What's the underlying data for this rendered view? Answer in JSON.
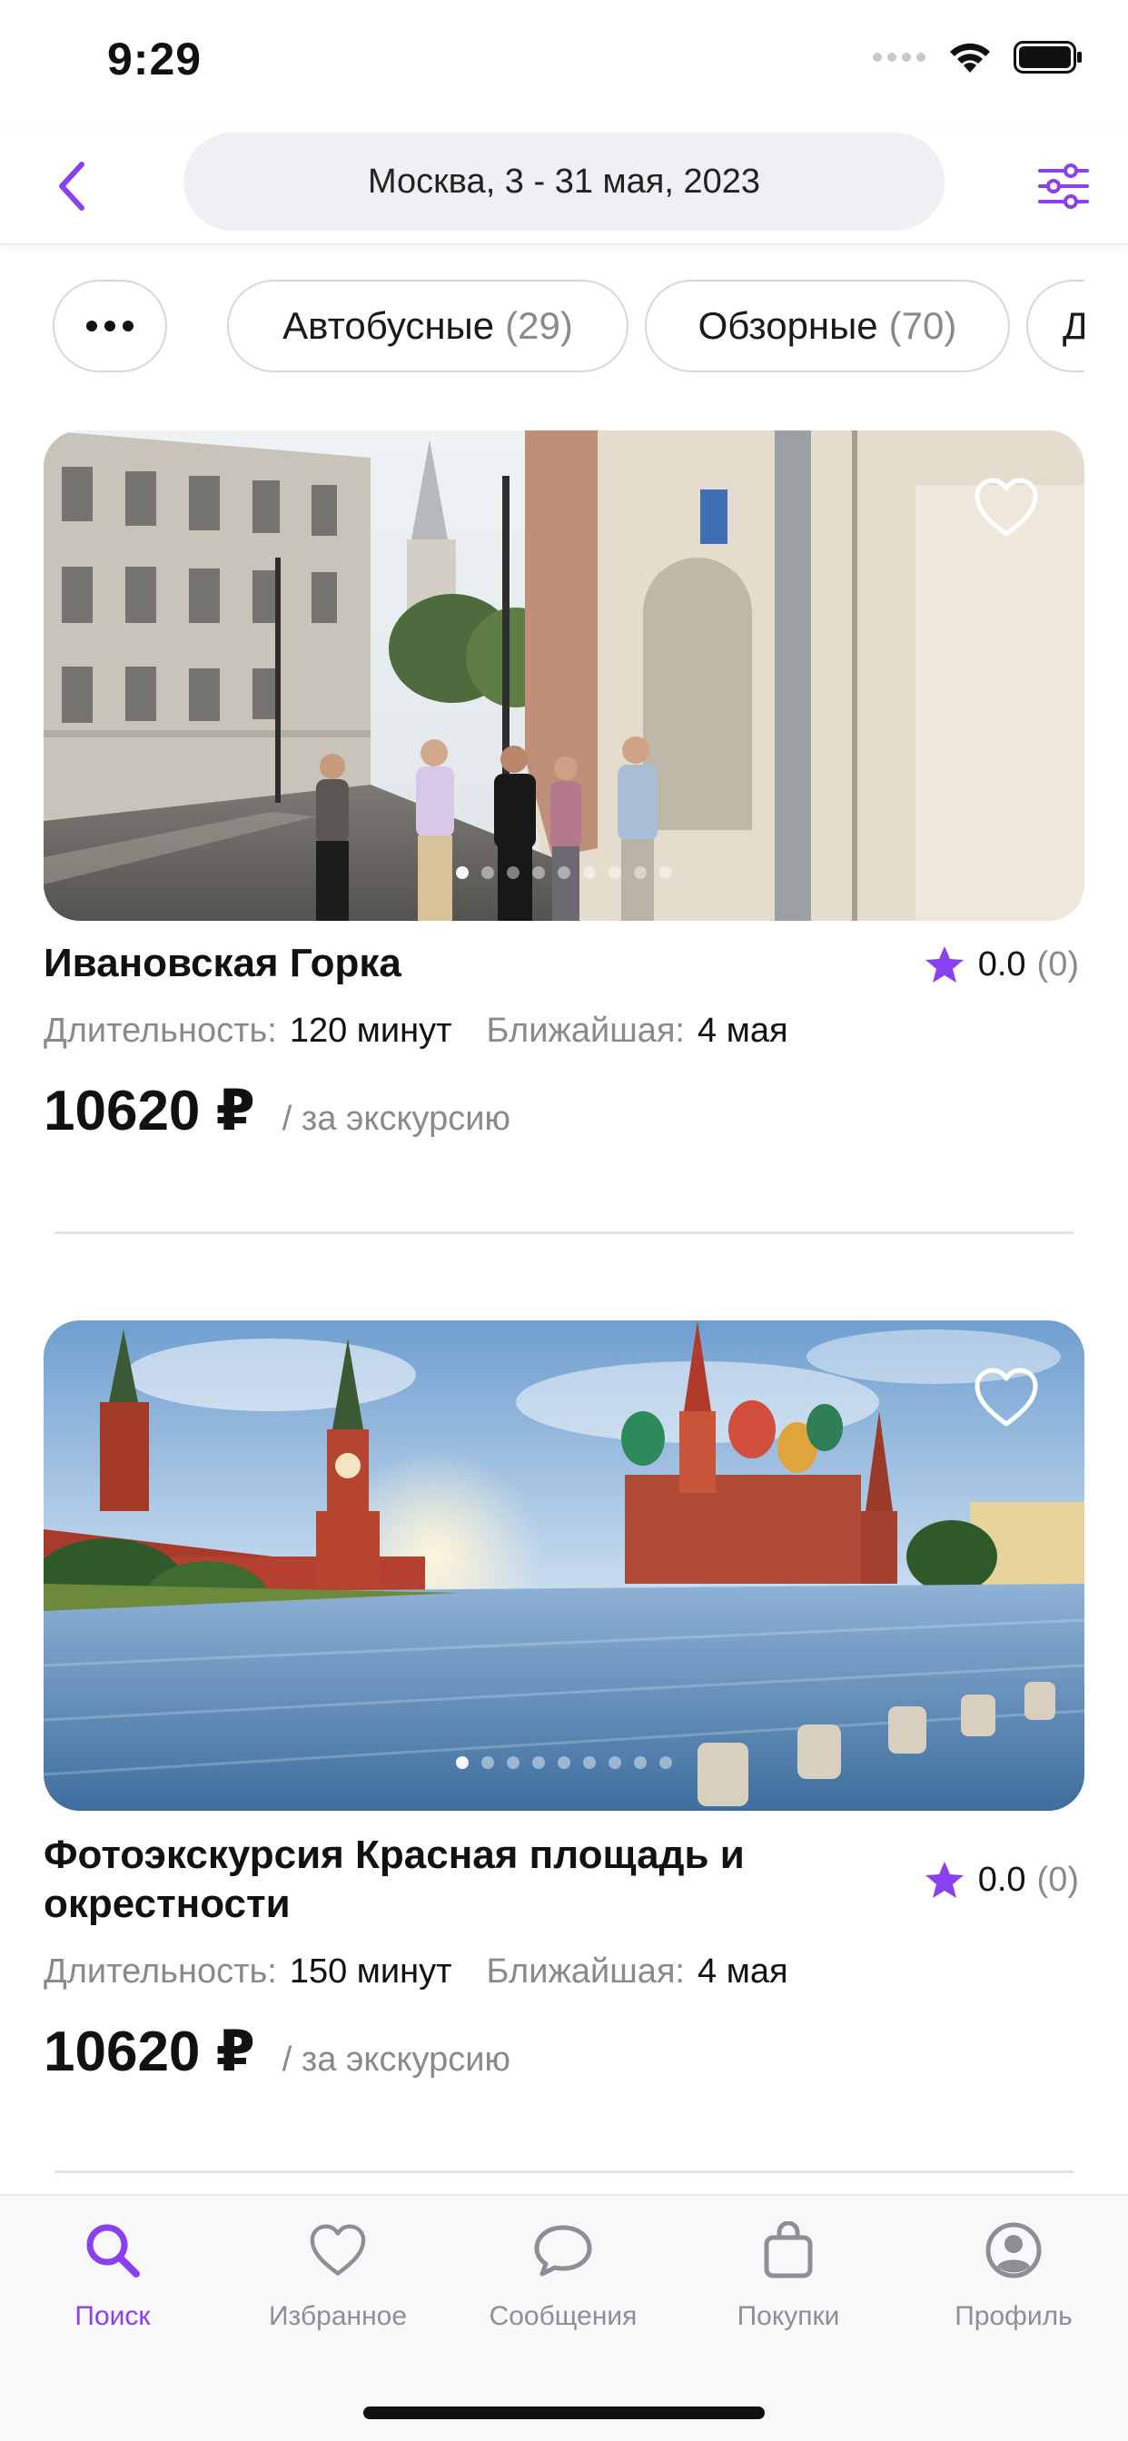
{
  "status_bar": {
    "time": "9:29"
  },
  "header": {
    "location_dates": "Москва, 3 - 31 мая, 2023"
  },
  "filters": [
    {
      "label": "Автобусные",
      "count": "(29)"
    },
    {
      "label": "Обзорные",
      "count": "(70)"
    },
    {
      "label": "Д",
      "count": ""
    }
  ],
  "tours": [
    {
      "title": "Ивановская Горка",
      "rating": "0.0",
      "reviews": "(0)",
      "duration_label": "Длительность:",
      "duration": "120 минут",
      "nearest_label": "Ближайшая:",
      "nearest": "4 мая",
      "price": "10620 ₽",
      "per": "/ за экскурсию",
      "photo_count": 9,
      "photo_index": 0
    },
    {
      "title": "Фотоэкскурсия Красная площадь и окрестности",
      "rating": "0.0",
      "reviews": "(0)",
      "duration_label": "Длительность:",
      "duration": "150 минут",
      "nearest_label": "Ближайшая:",
      "nearest": "4 мая",
      "price": "10620 ₽",
      "per": "/ за экскурсию",
      "photo_count": 9,
      "photo_index": 0
    }
  ],
  "tab_bar": {
    "active": "search",
    "items": [
      {
        "id": "search",
        "label": "Поиск",
        "icon": "search-icon"
      },
      {
        "id": "favorites",
        "label": "Избранное",
        "icon": "heart-icon"
      },
      {
        "id": "messages",
        "label": "Сообщения",
        "icon": "chat-bubble-icon"
      },
      {
        "id": "purchases",
        "label": "Покупки",
        "icon": "shopping-bag-icon"
      },
      {
        "id": "profile",
        "label": "Профиль",
        "icon": "user-circle-icon"
      }
    ]
  },
  "colors": {
    "accent": "#8A3FF0",
    "muted": "#8E8E93",
    "pill_bg": "#F0F0F4"
  }
}
